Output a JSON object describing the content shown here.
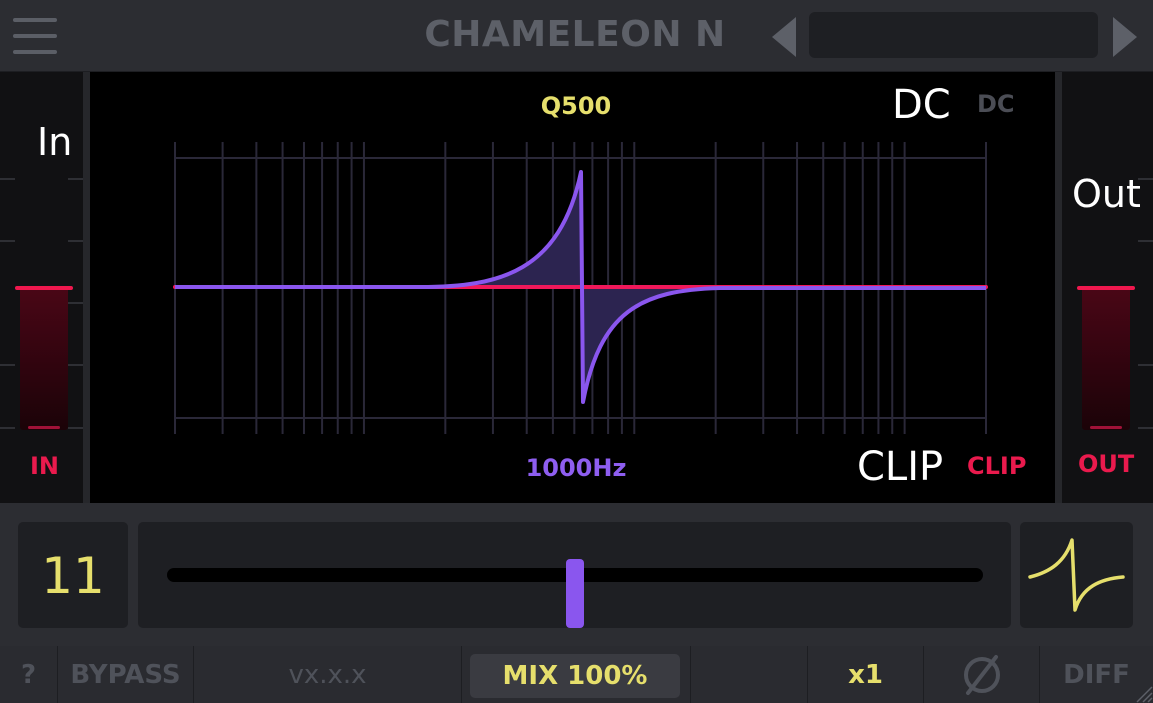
{
  "header": {
    "title": "CHAMELEON N",
    "preset_value": ""
  },
  "display": {
    "in_label": "In",
    "out_label": "Out",
    "in_tag": "IN",
    "out_tag": "OUT",
    "q_label": "Q500",
    "freq_label": "1000Hz",
    "dc_big": "DC",
    "dc_small": "DC",
    "clip_big": "CLIP",
    "clip_small": "CLIP"
  },
  "controls": {
    "value": "11",
    "slider_position": 0.5
  },
  "footer": {
    "help": "?",
    "bypass": "BYPASS",
    "version": "vx.x.x",
    "mix": "MIX  100%",
    "oversample": "x1",
    "diff": "DIFF"
  },
  "colors": {
    "accent_yellow": "#e6df6c",
    "accent_purple": "#8e5ef0",
    "accent_red": "#ea1a4d"
  }
}
